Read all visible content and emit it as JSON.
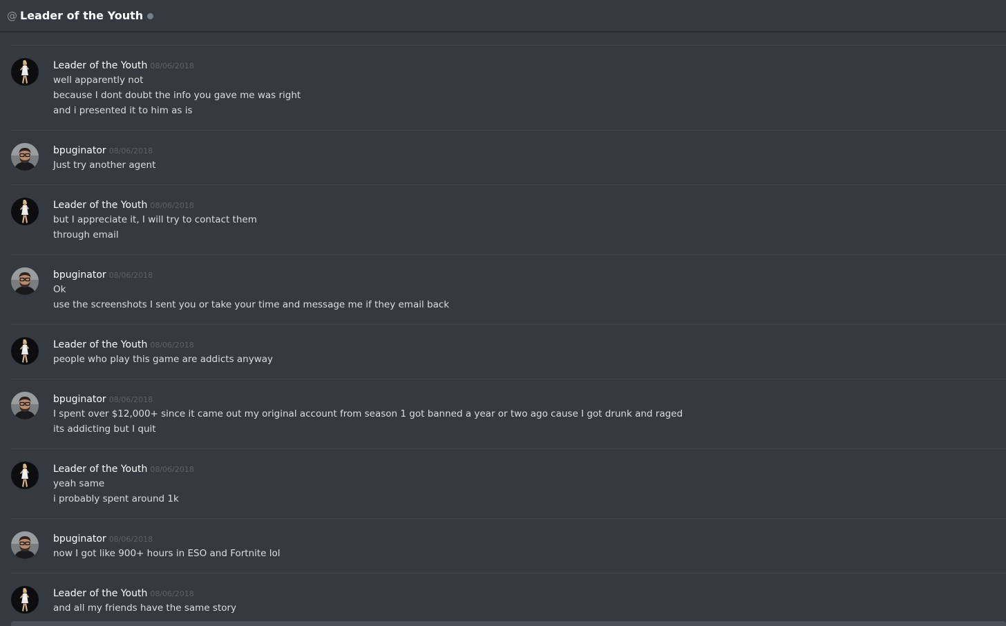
{
  "header": {
    "at_symbol": "@",
    "title": "Leader of the Youth",
    "status": "offline"
  },
  "colors": {
    "background": "#36393f",
    "username": "#ffffff",
    "timestamp": "#5e6168",
    "message_text": "#dcddde",
    "divider": "#40434a",
    "status_offline": "#747f8d"
  },
  "messages": [
    {
      "author": "Leader of the Youth",
      "avatar": "dancer-avatar",
      "timestamp": "08/06/2018",
      "lines": [
        "well apparently not",
        "because I dont doubt the info you gave me was right",
        "and i presented it to him as is"
      ]
    },
    {
      "author": "bpuginator",
      "avatar": "man-with-glasses-avatar",
      "timestamp": "08/06/2018",
      "lines": [
        "Just try another agent"
      ]
    },
    {
      "author": "Leader of the Youth",
      "avatar": "dancer-avatar",
      "timestamp": "08/06/2018",
      "lines": [
        "but I appreciate it, I will try to contact them",
        "through email"
      ]
    },
    {
      "author": "bpuginator",
      "avatar": "man-with-glasses-avatar",
      "timestamp": "08/06/2018",
      "lines": [
        "Ok",
        "use the screenshots I sent you or take your time and message me if they email back"
      ]
    },
    {
      "author": "Leader of the Youth",
      "avatar": "dancer-avatar",
      "timestamp": "08/06/2018",
      "lines": [
        "people who play this game are addicts anyway"
      ]
    },
    {
      "author": "bpuginator",
      "avatar": "man-with-glasses-avatar",
      "timestamp": "08/06/2018",
      "lines": [
        "I spent over $12,000+ since it came out my original account from season 1 got banned a year or two ago cause I got drunk and raged",
        "its addicting but I quit"
      ]
    },
    {
      "author": "Leader of the Youth",
      "avatar": "dancer-avatar",
      "timestamp": "08/06/2018",
      "lines": [
        "yeah same",
        "i probably spent around 1k"
      ]
    },
    {
      "author": "bpuginator",
      "avatar": "man-with-glasses-avatar",
      "timestamp": "08/06/2018",
      "lines": [
        "now I got like 900+ hours in ESO and Fortnite lol"
      ]
    },
    {
      "author": "Leader of the Youth",
      "avatar": "dancer-avatar",
      "timestamp": "08/06/2018",
      "lines": [
        "and all my friends have the same story"
      ]
    }
  ]
}
